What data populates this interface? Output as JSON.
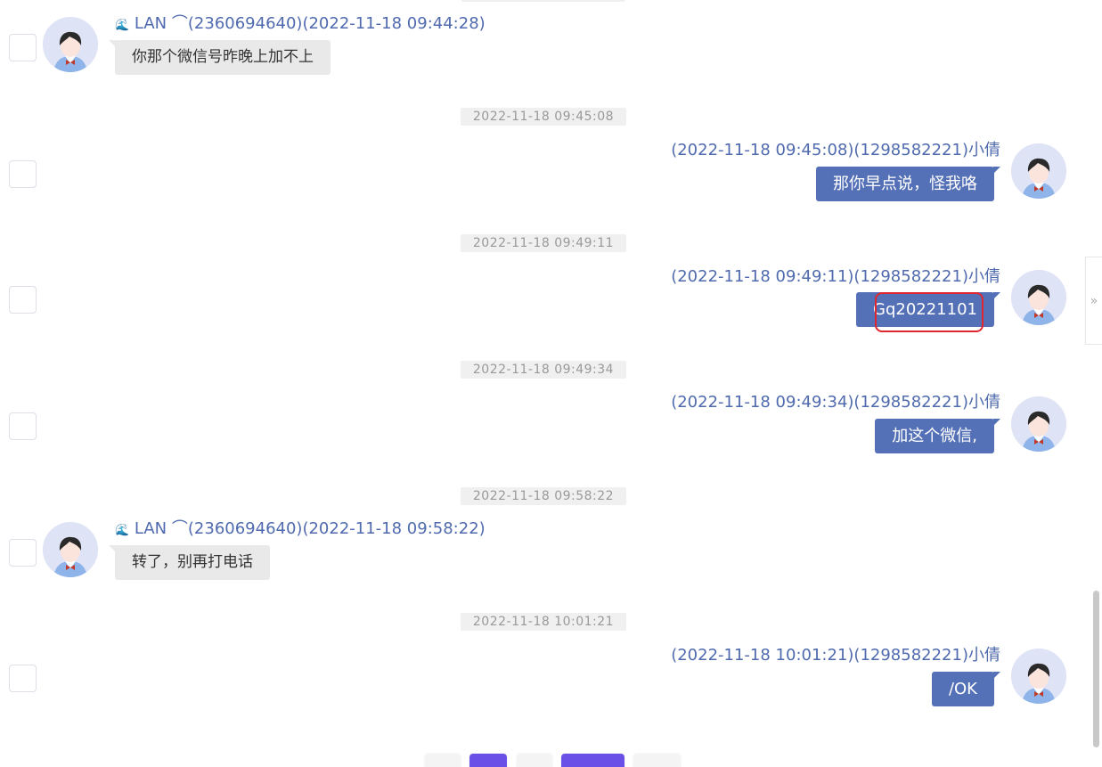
{
  "messages": [
    {
      "direction": "in",
      "sender_tag": "🌊",
      "sender_name": "LAN",
      "sender_suffix": "⌒(2360694640)(2022-11-18 09:44:28)",
      "text": "你那个微信号昨晚上加不上"
    },
    {
      "direction": "out",
      "timestamp": "2022-11-18 09:45:08",
      "header": "(2022-11-18 09:45:08)(1298582221)小倩",
      "text": "那你早点说，怪我咯"
    },
    {
      "direction": "out",
      "timestamp": "2022-11-18 09:49:11",
      "header": "(2022-11-18 09:49:11)(1298582221)小倩",
      "text": "Gq20221101",
      "highlighted": true
    },
    {
      "direction": "out",
      "timestamp": "2022-11-18 09:49:34",
      "header": "(2022-11-18 09:49:34)(1298582221)小倩",
      "text": "加这个微信,"
    },
    {
      "direction": "in",
      "timestamp": "2022-11-18 09:58:22",
      "sender_tag": "🌊",
      "sender_name": "LAN",
      "sender_suffix": "⌒(2360694640)(2022-11-18 09:58:22)",
      "text": "转了，别再打电话"
    },
    {
      "direction": "out",
      "timestamp": "2022-11-18 10:01:21",
      "header": "(2022-11-18 10:01:21)(1298582221)小倩",
      "text": "/OK"
    }
  ],
  "side_toggle": {
    "icon": "chevrons-right-icon",
    "glyph": "»"
  },
  "colors": {
    "outgoing_bubble": "#5470b6",
    "incoming_bubble": "#e9e9e9",
    "sender_name": "#4f6aae",
    "highlight": "#e0262e",
    "pager_active": "#6a50e6"
  }
}
